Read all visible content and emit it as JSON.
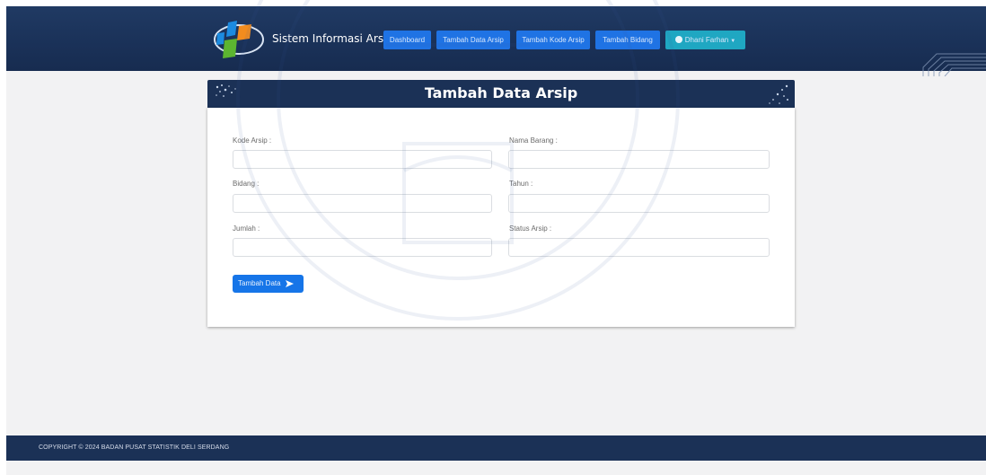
{
  "navbar": {
    "brand": "Sistem Informasi Arsip",
    "items": [
      {
        "label": "Dashboard"
      },
      {
        "label": "Tambah Data Arsip"
      },
      {
        "label": "Tambah Kode Arsip"
      },
      {
        "label": "Tambah Bidang"
      }
    ],
    "user": {
      "label": "Dhani Farhan"
    }
  },
  "form": {
    "title": "Tambah Data Arsip",
    "fields": [
      {
        "label": "Kode Arsip :",
        "value": ""
      },
      {
        "label": "Nama Barang :",
        "value": ""
      },
      {
        "label": "Bidang :",
        "value": ""
      },
      {
        "label": "Tahun :",
        "value": ""
      },
      {
        "label": "Jumlah :",
        "value": ""
      },
      {
        "label": "Status Arsip :",
        "value": ""
      }
    ],
    "submit_label": "Tambah Data"
  },
  "footer": {
    "text": "COPYRIGHT © 2024 BADAN PUSAT STATISTIK DELI SERDANG"
  },
  "colors": {
    "navbar": "#1b3156",
    "nav_button": "#1f73e4",
    "user_button": "#1fa7c2",
    "submit_button": "#1675e8"
  },
  "icons": {
    "logo": "bps-logo",
    "user": "user-circle-icon",
    "submit": "paper-plane-icon"
  }
}
